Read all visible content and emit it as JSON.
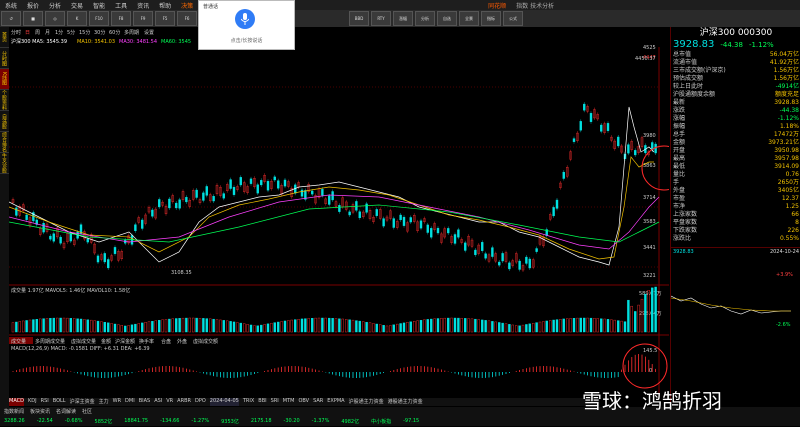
{
  "menu": [
    "系统",
    "报价",
    "分析",
    "交易",
    "智能",
    "工具",
    "资讯",
    "帮助",
    "决策"
  ],
  "app": {
    "subtitle": "同花顺",
    "tabs": [
      "指数 技术分析"
    ]
  },
  "toolbar": [
    "↺",
    "■",
    "◎",
    "K",
    "F10",
    "F8",
    "F9",
    "F5",
    "F6",
    "BBD",
    "RTY",
    "涨幅",
    "分析",
    "自选",
    "全景",
    "指标",
    "公式"
  ],
  "voice": {
    "title": "普通话",
    "hint": "点击/长按说话"
  },
  "left_tabs": [
    "首页",
    "分时图",
    "K线图",
    "个股资料",
    "自选股",
    "综合排名",
    "牛叉诊股"
  ],
  "main": {
    "period_tabs": [
      "分时",
      "日",
      "周",
      "月",
      "1分",
      "5分",
      "15分",
      "30分",
      "60分",
      "多周期",
      "设置"
    ],
    "ma_legend": [
      "沪深300  MA5: 3545.39",
      "MA10: 3541.03",
      "MA30: 3481.54",
      "MA60: 3545"
    ],
    "high_label": "4450.37",
    "low_label": "3108.35",
    "price_axis": [
      "4525",
      "4447",
      "3980",
      "3863",
      "3714",
      "3583",
      "3441",
      "3221"
    ],
    "vol_label": "成交量 1.97亿  MAVOL5: 1.46亿  MAVOL10: 1.58亿",
    "vol_axis": [
      "589.67万",
      "298.04万"
    ],
    "indicator_tabs": [
      "成交量",
      "多周期成交量",
      "虚拟成交量",
      "金额",
      "沪深金额",
      "换手率",
      "合盘",
      "外盘",
      "虚拟成交额"
    ],
    "macd_label": "MACD(12,26,9) MACD: -0.1581  DIFF: +6.31  DEA: +6.39",
    "macd_axis": [
      "145.5",
      "0"
    ],
    "bottom_tabs": [
      "MACD",
      "KDJ",
      "RSI",
      "BOLL",
      "沪深主资金",
      "主力",
      "WR",
      "DMI",
      "BIAS",
      "ASI",
      "VR",
      "ARBR",
      "DPO",
      "TRIX",
      "BBI",
      "SRI",
      "MTM",
      "OBV",
      "SAR",
      "EXPMA",
      "沪股通主力资金",
      "港股通主力资金"
    ],
    "date_label": "2024-04-05",
    "bottom_row": [
      "指数新闻",
      "板块资讯",
      "名词解读",
      "社区"
    ]
  },
  "right": {
    "title": "沪深300 000300",
    "price": "3928.83",
    "chg": "-44.38",
    "pct": "-1.12%",
    "rows": [
      [
        "总市值",
        "56.04万亿"
      ],
      [
        "流通市值",
        "41.92万亿"
      ],
      [
        "三市成交额(沪深京)",
        "1.56万亿"
      ],
      [
        "预估成交额",
        "1.56万亿"
      ],
      [
        "较上日此时",
        "-4914亿"
      ],
      [
        "沪股通额度余额",
        "额度充足"
      ],
      [
        "最新",
        "3928.83"
      ],
      [
        "涨跌",
        "-44.38"
      ],
      [
        "涨幅",
        "-1.12%"
      ],
      [
        "振幅",
        "1.18%"
      ],
      [
        "总手",
        "17472万"
      ],
      [
        "金额",
        "3973.21亿"
      ],
      [
        "开盘",
        "3950.98"
      ],
      [
        "最高",
        "3957.98"
      ],
      [
        "最低",
        "3914.09"
      ],
      [
        "量比",
        "0.76"
      ],
      [
        "手",
        "2650万"
      ],
      [
        "外盘",
        "3405亿"
      ],
      [
        "市盈",
        "12.37"
      ],
      [
        "市净",
        "1.25"
      ],
      [
        "上涨家数",
        "66"
      ],
      [
        "平盘家数",
        "8"
      ],
      [
        "下跌家数",
        "226"
      ],
      [
        "涨跌比",
        "0.55%"
      ]
    ],
    "mini": {
      "date": "2024-10-24",
      "val": "3928.83",
      "axis": [
        "+3.9%",
        "-2.6%"
      ]
    }
  },
  "status": {
    "items": [
      "3288.26",
      "-22.54",
      "-0.68%",
      "5852亿",
      "18841.75",
      "-134.66",
      "-1.27%",
      "9353亿",
      "2175.18",
      "-30.20",
      "-1.37%",
      "4982亿",
      "中小板指",
      "-97.15"
    ]
  },
  "watermark": "雪球：鸿鹄折羽"
}
